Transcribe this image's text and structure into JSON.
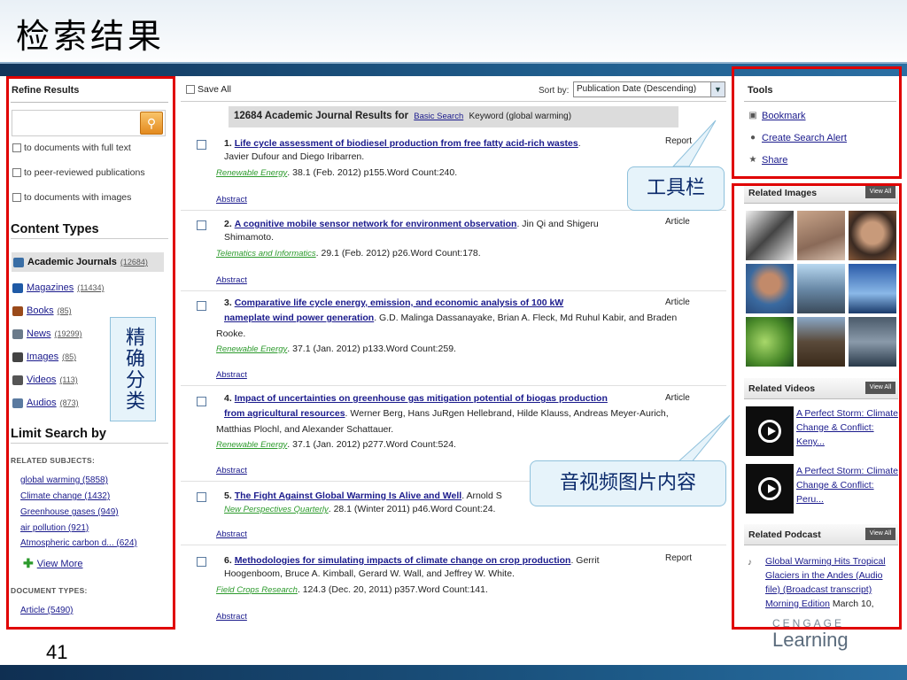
{
  "slide": {
    "title": "检索结果",
    "page_number": "41",
    "logo_text": "Learning",
    "logo_top": "CENGAGE"
  },
  "refine": {
    "title": "Refine Results",
    "search_placeholder": "",
    "filters": [
      {
        "label": "to documents with full text"
      },
      {
        "label": "to peer-reviewed publications"
      },
      {
        "label": "to documents with images"
      }
    ],
    "content_types_title": "Content Types",
    "content_types": [
      {
        "label": "Academic Journals",
        "count": "(12684)",
        "icon": "journal-icon",
        "color": "#3a6ea5"
      },
      {
        "label": "Magazines",
        "count": "(11434)",
        "icon": "magazine-icon",
        "color": "#1f5aa6"
      },
      {
        "label": "Books",
        "count": "(85)",
        "icon": "book-icon",
        "color": "#9a4a1a"
      },
      {
        "label": "News",
        "count": "(19299)",
        "icon": "news-icon",
        "color": "#6a7a8a"
      },
      {
        "label": "Images",
        "count": "(85)",
        "icon": "camera-icon",
        "color": "#444"
      },
      {
        "label": "Videos",
        "count": "(113)",
        "icon": "video-icon",
        "color": "#555"
      },
      {
        "label": "Audios",
        "count": "(873)",
        "icon": "speaker-icon",
        "color": "#5a7aa0"
      }
    ],
    "limit_title": "Limit Search by",
    "related_subjects_label": "RELATED SUBJECTS:",
    "subjects": [
      "global warming (5858)",
      "Climate change (1432)",
      "Greenhouse gases (949)",
      "air pollution (921)",
      "Atmospheric carbon d... (624)"
    ],
    "view_more": "View More",
    "document_types_label": "DOCUMENT TYPES:",
    "document_types": [
      "Article (5490)"
    ]
  },
  "results": {
    "save_all": "Save All",
    "sort_by_label": "Sort by:",
    "sort_value": "Publication Date (Descending)",
    "header_count": "12684 Academic Journal Results for",
    "header_link": "Basic Search",
    "header_keyword": "Keyword (global warming)",
    "abstract_label": "Abstract",
    "items": [
      {
        "num": "1.",
        "title": "Life cycle assessment of biodiesel production from free fatty acid-rich wastes",
        "authors_line1": ".",
        "authors_line2": "Javier Dufour and Diego Iribarren.",
        "doctype": "Report",
        "source": "Renewable Energy",
        "details": ". 38.1 (Feb. 2012) p155.Word Count:240."
      },
      {
        "num": "2.",
        "title": "A cognitive mobile sensor network for environment observation",
        "authors_line1": ". Jin Qi and Shigeru",
        "authors_line2": "Shimamoto.",
        "doctype": "Article",
        "source": "Telematics and Informatics",
        "details": ". 29.1 (Feb. 2012) p26.Word Count:178."
      },
      {
        "num": "3.",
        "title_part1": "Comparative life cycle energy, emission, and economic analysis of 100 kW",
        "title_part2": "nameplate wind power generation",
        "authors_line1": ". G.D. Malinga Dassanayake, Brian A. Fleck, Md Ruhul Kabir, and Braden",
        "authors_line2": "Rooke.",
        "doctype": "Article",
        "source": "Renewable Energy",
        "details": ". 37.1 (Jan. 2012) p133.Word Count:259."
      },
      {
        "num": "4.",
        "title_part1": "Impact of uncertainties on greenhouse gas mitigation potential of biogas production",
        "title_part2": "from agricultural resources",
        "authors_line1": ". Werner Berg, Hans JuRgen Hellebrand, Hilde Klauss, Andreas Meyer-Aurich,",
        "authors_line2": "Matthias Plochl, and Alexander Schattauer.",
        "doctype": "Article",
        "source": "Renewable Energy",
        "details": ". 37.1 (Jan. 2012) p277.Word Count:524."
      },
      {
        "num": "5.",
        "title": "The Fight Against Global Warming Is Alive and Well",
        "authors_line1": ". Arnold S",
        "doctype": "",
        "source": "New Perspectives Quarterly",
        "details": ". 28.1 (Winter 2011) p46.Word Count:24."
      },
      {
        "num": "6.",
        "title": "Methodologies for simulating impacts of climate change on crop production",
        "authors_line1": ". Gerrit",
        "authors_line2": "Hoogenboom, Bruce A. Kimball, Gerard W. Wall, and Jeffrey W. White.",
        "doctype": "Report",
        "source": "Field Crops Research",
        "details": ". 124.3 (Dec. 20, 2011) p357.Word Count:141."
      }
    ]
  },
  "tools": {
    "title": "Tools",
    "items": [
      {
        "label": "Bookmark",
        "icon": "bookmark-icon"
      },
      {
        "label": "Create Search Alert",
        "icon": "alert-icon"
      },
      {
        "label": "Share",
        "icon": "share-icon"
      }
    ]
  },
  "related": {
    "images_title": "Related Images",
    "videos_title": "Related Videos",
    "podcast_title": "Related Podcast",
    "view_all": "View All",
    "videos": [
      {
        "title": "A Perfect Storm: Climate Change & Conflict: Keny..."
      },
      {
        "title": "A Perfect Storm: Climate Change & Conflict: Peru..."
      }
    ],
    "podcast_link": "Global Warming Hits Tropical Glaciers in the Andes (Audio file) (Broadcast transcript) Morning Edition",
    "podcast_date": " March 10,"
  },
  "callouts": {
    "tools": "工具栏",
    "content_types": "精确分类",
    "media": "音视频图片内容"
  },
  "colors": {
    "annotation_red": "#e00000",
    "link_blue": "#1a1a8c",
    "source_green": "#2c9a2c",
    "callout_bg": "#e6f3fa",
    "callout_text": "#0b2a6b"
  }
}
